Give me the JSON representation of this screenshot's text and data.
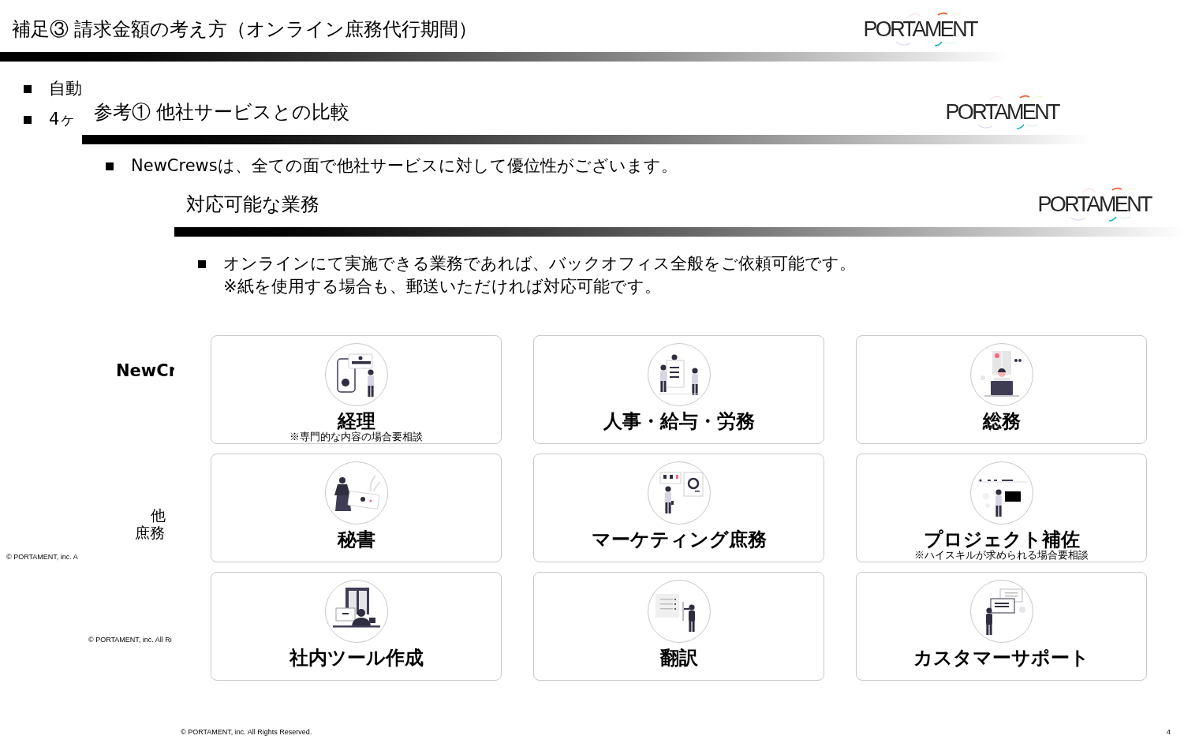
{
  "slides": [
    {
      "title": "補足③ 請求金額の考え方（オンライン庶務代行期間）",
      "logo": "PORTAMENT",
      "bullets": [
        {
          "lines": [
            "自動"
          ]
        },
        {
          "lines": [
            "4ヶ"
          ]
        }
      ],
      "footer": "© PORTAMENT, inc. A"
    },
    {
      "title": "参考① 他社サービスとの比較",
      "logo": "PORTAMENT",
      "bullets": [
        {
          "lines": [
            "NewCrewsは、全ての面で他社サービスに対して優位性がございます。"
          ]
        }
      ],
      "comparison": {
        "column_heading": "NewCr",
        "row_heading_lines": [
          "他",
          "庶務"
        ]
      },
      "footer": "© PORTAMENT, inc. All Ri"
    },
    {
      "title": "対応可能な業務",
      "logo": "PORTAMENT",
      "bullets": [
        {
          "lines": [
            "オンラインにて実施できる業務であれば、バックオフィス全般をご依頼可能です。",
            "※紙を使用する場合も、郵送いただければ対応可能です。"
          ]
        }
      ],
      "services": [
        {
          "name": "経理",
          "note": "※専門的な内容の場合要相談"
        },
        {
          "name": "人事・給与・労務"
        },
        {
          "name": "総務"
        },
        {
          "name": "秘書"
        },
        {
          "name": "マーケティング庶務"
        },
        {
          "name": "プロジェクト補佐",
          "note": "※ハイスキルが求められる場合要相談"
        },
        {
          "name": "社内ツール作成"
        },
        {
          "name": "翻訳"
        },
        {
          "name": "カスタマーサポート"
        }
      ],
      "footer": "© PORTAMENT, inc. All Rights Reserved.",
      "page_number": "4"
    }
  ]
}
